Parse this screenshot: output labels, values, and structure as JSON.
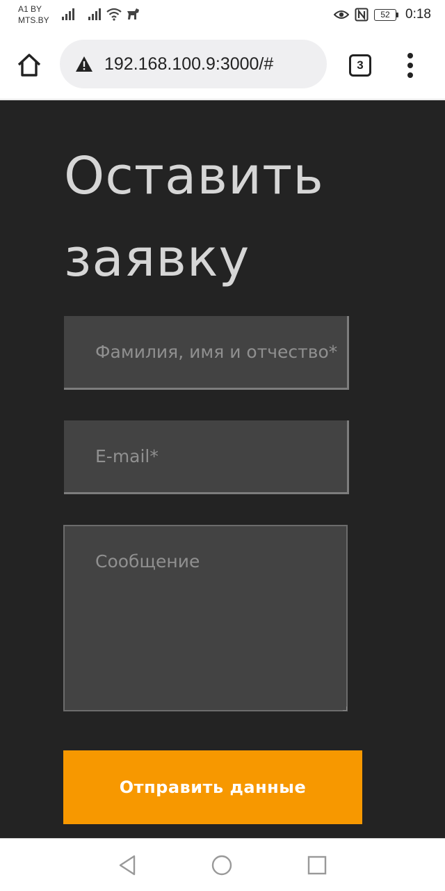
{
  "status_bar": {
    "carrier_line1": "A1 BY",
    "carrier_line2": "MTS.BY",
    "battery_level": "52",
    "time": "0:18",
    "icons": [
      "signal-icon",
      "signal-icon",
      "wifi-icon",
      "dog-icon",
      "eye-icon",
      "nfc-icon",
      "battery-icon"
    ]
  },
  "browser": {
    "url": "192.168.100.9:3000/#",
    "tab_count": "3",
    "icons": [
      "home-icon",
      "warning-icon",
      "tabs-icon",
      "more-vertical-icon"
    ]
  },
  "form": {
    "title": "Оставить заявку",
    "name_placeholder": "Фамилия, имя и отчество*",
    "email_placeholder": "E-mail*",
    "message_placeholder": "Сообщение",
    "submit_label": "Отправить данные"
  },
  "nav_bar": {
    "icons": [
      "back-icon",
      "home-icon",
      "recents-icon"
    ]
  },
  "colors": {
    "page_background": "#232323",
    "field_background": "#434343",
    "accent": "#f79800",
    "title_text": "#d6d6d6"
  }
}
